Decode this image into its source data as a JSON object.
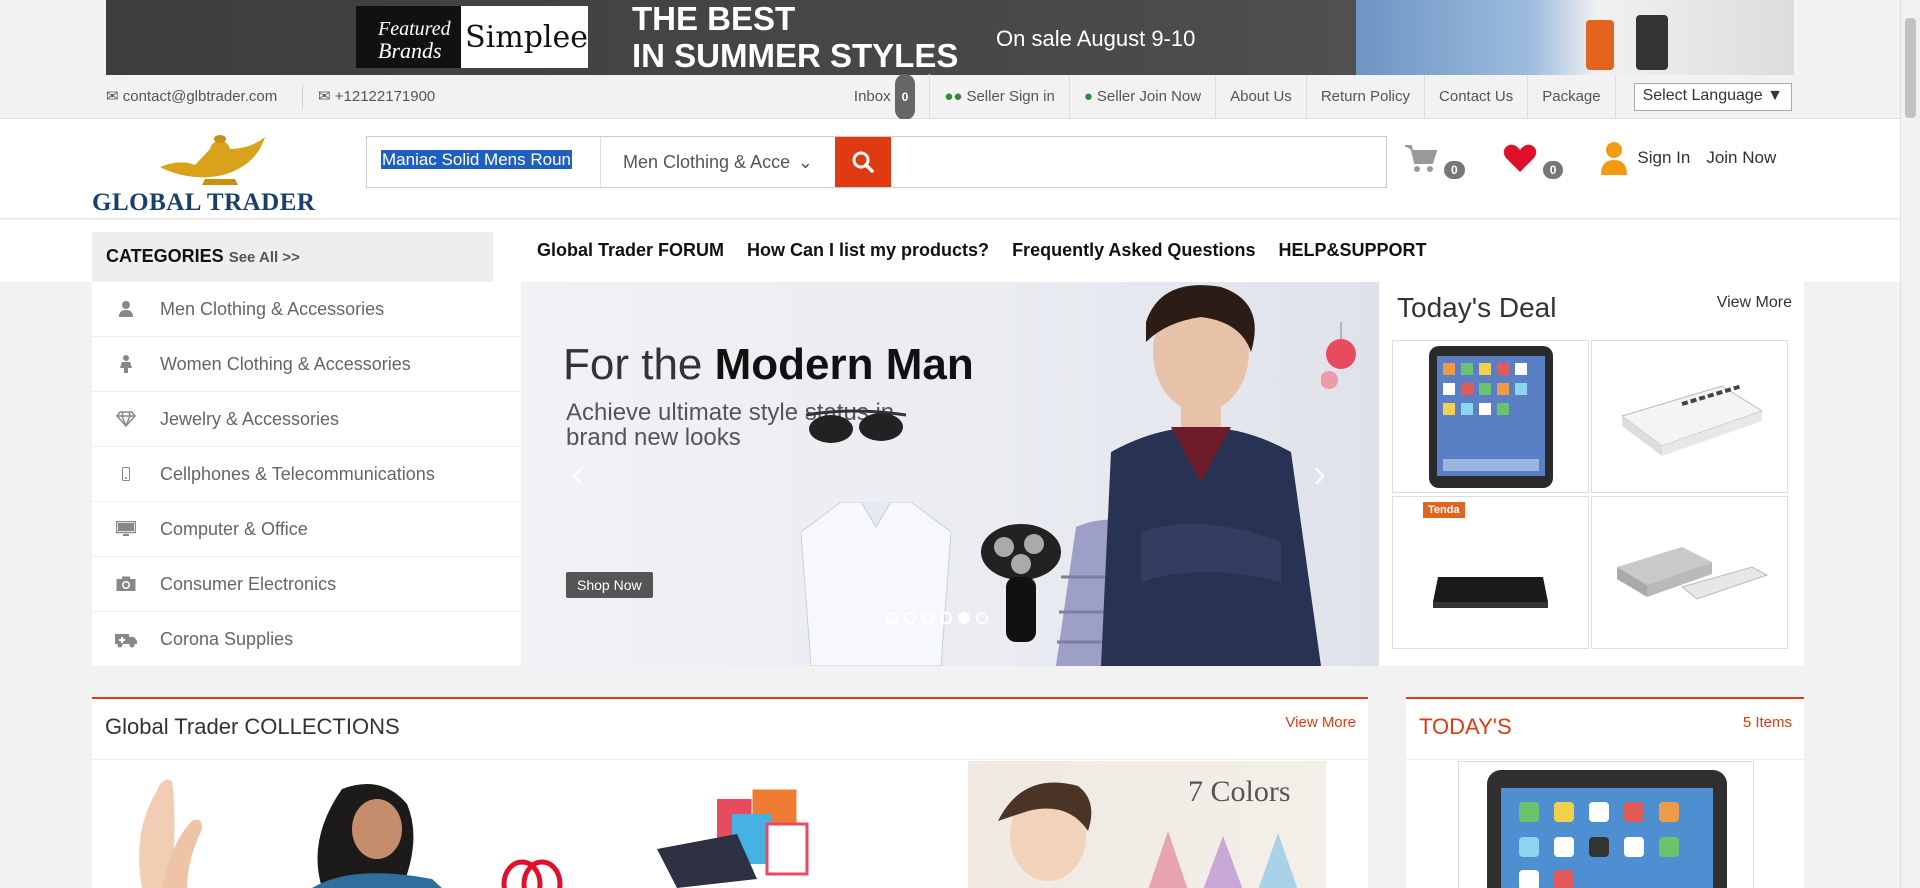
{
  "banner": {
    "featured_line1": "Featured",
    "featured_line2": "Brands",
    "brand_name": "Simplee",
    "headline_line1": "THE BEST",
    "headline_line2": "IN SUMMER STYLES",
    "sale_text": "On sale August 9-10"
  },
  "contact": {
    "email": "contact@glbtrader.com",
    "phone": "+12122171900"
  },
  "topnav": {
    "inbox_label": "Inbox",
    "inbox_count": "0",
    "seller_signin": "Seller Sign in",
    "seller_join": "Seller Join Now",
    "about": "About Us",
    "return_policy": "Return Policy",
    "contact_us": "Contact Us",
    "package": "Package",
    "language_select": "Select Language"
  },
  "header": {
    "logo_text": "GLOBAL TRADER",
    "search_value": "Maniac Solid Mens Roun",
    "search_category": "Men Clothing & Acce",
    "cart_count": "0",
    "wishlist_count": "0",
    "sign_in": "Sign In",
    "join_now": "Join Now"
  },
  "categories": {
    "heading": "CATEGORIES",
    "see_all": "See All >>",
    "items": [
      {
        "label": "Men Clothing & Accessories",
        "icon": "user-icon"
      },
      {
        "label": "Women Clothing & Accessories",
        "icon": "female-icon"
      },
      {
        "label": "Jewelry & Accessories",
        "icon": "diamond-icon"
      },
      {
        "label": "Cellphones & Telecommunications",
        "icon": "mobile-icon"
      },
      {
        "label": "Computer & Office",
        "icon": "desktop-icon"
      },
      {
        "label": "Consumer Electronics",
        "icon": "camera-icon"
      },
      {
        "label": "Corona Supplies",
        "icon": "ambulance-icon"
      }
    ]
  },
  "mainnav": {
    "forum": "Global Trader FORUM",
    "list_products": "How Can I list my products?",
    "faq": "Frequently Asked Questions",
    "help": "HELP&SUPPORT"
  },
  "slider": {
    "title_light": "For the ",
    "title_bold": "Modern Man",
    "subtitle": "Achieve ultimate style status in brand new looks",
    "button": "Shop Now",
    "dot_count": 6,
    "active_dot": 4
  },
  "deal": {
    "title": "Today's Deal",
    "view_more": "View More",
    "tenda_label": "Tenda"
  },
  "collections": {
    "title": "Global Trader COLLECTIONS",
    "view_more": "View More",
    "seven_colors": "7 Colors"
  },
  "today": {
    "title": "TODAY'S",
    "items": "5 Items"
  },
  "colors": {
    "accent": "#e03a12",
    "logo_blue": "#1b3f6b",
    "heart": "#e0102b",
    "user_orange": "#f29a12"
  }
}
